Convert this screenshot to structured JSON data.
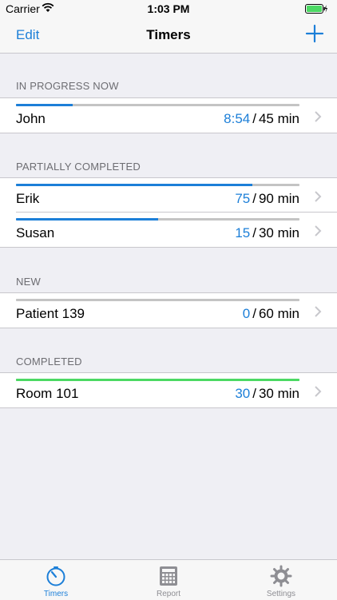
{
  "status_bar": {
    "carrier": "Carrier",
    "time": "1:03 PM"
  },
  "nav": {
    "edit_label": "Edit",
    "title": "Timers"
  },
  "sections": [
    {
      "header": "IN PROGRESS NOW",
      "items": [
        {
          "name": "John",
          "elapsed": "8:54",
          "total": "45 min",
          "progress": 0.2,
          "bar": "#1c7fd8"
        }
      ]
    },
    {
      "header": "PARTIALLY COMPLETED",
      "items": [
        {
          "name": "Erik",
          "elapsed": "75",
          "total": "90 min",
          "progress": 0.833,
          "bar": "#1c7fd8"
        },
        {
          "name": "Susan",
          "elapsed": "15",
          "total": "30 min",
          "progress": 0.5,
          "bar": "#1c7fd8"
        }
      ]
    },
    {
      "header": "NEW",
      "items": [
        {
          "name": "Patient 139",
          "elapsed": "0",
          "total": "60 min",
          "progress": 0.0,
          "bar": "#1c7fd8"
        }
      ]
    },
    {
      "header": "COMPLETED",
      "items": [
        {
          "name": "Room 101",
          "elapsed": "30",
          "total": "30 min",
          "progress": 1.0,
          "bar": "#4cd964"
        }
      ]
    }
  ],
  "tabs": [
    {
      "label": "Timers",
      "icon": "stopwatch-icon",
      "active": true
    },
    {
      "label": "Report",
      "icon": "calculator-icon",
      "active": false
    },
    {
      "label": "Settings",
      "icon": "gear-icon",
      "active": false
    }
  ],
  "colors": {
    "accent": "#1c7fd8",
    "complete": "#4cd964",
    "track": "#c4c4c4"
  }
}
